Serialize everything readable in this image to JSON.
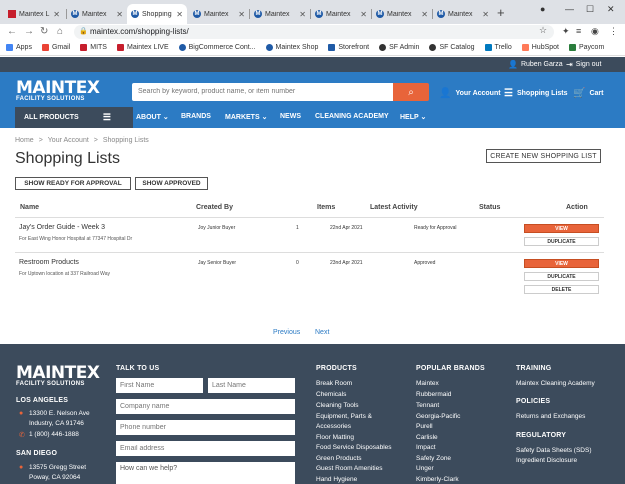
{
  "browser": {
    "tabs": [
      {
        "label": "Maintex L",
        "favicon": "maintex"
      },
      {
        "label": "Maintex",
        "favicon": "m"
      },
      {
        "label": "Shopping",
        "favicon": "m",
        "active": true
      },
      {
        "label": "Maintex",
        "favicon": "m"
      },
      {
        "label": "Maintex",
        "favicon": "m"
      },
      {
        "label": "Maintex",
        "favicon": "m"
      },
      {
        "label": "Maintex",
        "favicon": "m"
      },
      {
        "label": "Maintex",
        "favicon": "m"
      }
    ],
    "url": "maintex.com/shopping-lists/",
    "bookmarks": [
      {
        "label": "Apps",
        "color": "#4285f4"
      },
      {
        "label": "Gmail",
        "color": "#ea4335"
      },
      {
        "label": "MITS",
        "color": "#c61e2c"
      },
      {
        "label": "Maintex LIVE",
        "color": "#c61e2c"
      },
      {
        "label": "BigCommerce Cont...",
        "color": "#1f5aa6"
      },
      {
        "label": "Maintex Shop",
        "color": "#1f5aa6"
      },
      {
        "label": "Storefront",
        "color": "#1f5aa6"
      },
      {
        "label": "SF Admin",
        "color": "#333333"
      },
      {
        "label": "SF Catalog",
        "color": "#333333"
      },
      {
        "label": "Trello",
        "color": "#0079bf"
      },
      {
        "label": "HubSpot",
        "color": "#ff7a59"
      },
      {
        "label": "Paycom",
        "color": "#2a7d3c"
      }
    ]
  },
  "site": {
    "user_name": "Ruben Garza",
    "sign_out": "Sign out",
    "logo_main": "MAINTEX",
    "logo_sub": "FACILITY SOLUTIONS",
    "search_placeholder": "Search by keyword, product name, or item number",
    "your_account": "Your Account",
    "shopping_lists": "Shopping Lists",
    "cart": "Cart",
    "all_products": "ALL PRODUCTS",
    "nav": {
      "about": "ABOUT",
      "brands": "BRANDS",
      "markets": "MARKETS",
      "news": "NEWS",
      "academy": "CLEANING ACADEMY",
      "help": "HELP"
    }
  },
  "content": {
    "breadcrumb": [
      "Home",
      "Your Account",
      "Shopping Lists"
    ],
    "title": "Shopping Lists",
    "create_button": "CREATE NEW SHOPPING LIST",
    "show_ready": "SHOW READY FOR APPROVAL",
    "show_approved": "SHOW APPROVED",
    "columns": {
      "name": "Name",
      "created_by": "Created By",
      "items": "Items",
      "latest_activity": "Latest Activity",
      "status": "Status",
      "action": "Action"
    },
    "rows": [
      {
        "name": "Jay's Order Guide - Week 3",
        "location": "For East Wing Honor Hospital at 77347 Hospital Dr",
        "created_by": "Joy Junior Buyer",
        "items": "1",
        "latest_activity": "22nd Apr 2021",
        "status": "Ready for Approval",
        "actions": [
          "VIEW",
          "DUPLICATE"
        ]
      },
      {
        "name": "Restroom Products",
        "location": "For Uptown location at 337 Railroad Way",
        "created_by": "Jay Senior Buyer",
        "items": "0",
        "latest_activity": "23nd Apr 2021",
        "status": "Approved",
        "actions": [
          "VIEW",
          "DUPLICATE",
          "DELETE"
        ]
      }
    ],
    "previous": "Previous",
    "next": "Next"
  },
  "footer": {
    "logo_main": "MAINTEX",
    "logo_sub": "FACILITY SOLUTIONS",
    "los_angeles": "LOS ANGELES",
    "la_addr1": "13300 E. Nelson Ave",
    "la_addr2": "Industry, CA 91746",
    "phone": "1 (800) 446-1888",
    "san_diego": "SAN DIEGO",
    "sd_addr1": "13575 Gregg Street",
    "sd_addr2": "Poway, CA 92064",
    "talk_to_us": "TALK TO US",
    "first_name": "First Name",
    "last_name": "Last Name",
    "company": "Company name",
    "phone_number": "Phone number",
    "email": "Email address",
    "help": "How can we help?",
    "products_head": "PRODUCTS",
    "products": [
      "Break Room",
      "Chemicals",
      "Cleaning Tools",
      "Equipment, Parts &",
      "Accessories",
      "Floor Matting",
      "Food Service Disposables",
      "Green Products",
      "Guest Room Amenities",
      "Hand Hygiene"
    ],
    "brands_head": "POPULAR BRANDS",
    "brands": [
      "Maintex",
      "Rubbermaid",
      "Tennant",
      "Georgia-Pacific",
      "Purell",
      "Carlisle",
      "Impact",
      "Safety Zone",
      "Unger",
      "Kimberly-Clark"
    ],
    "training_head": "TRAINING",
    "training": "Maintex Cleaning Academy",
    "policies_head": "POLICIES",
    "policies": "Returns and Exchanges",
    "regulatory_head": "REGULATORY",
    "regulatory1": "Safety Data Sheets (SDS)",
    "regulatory2": "Ingredient Disclosure"
  },
  "colors": {
    "brand_blue": "#2c7bc4",
    "dark": "#3c4b5c",
    "accent_orange": "#e8643a"
  }
}
